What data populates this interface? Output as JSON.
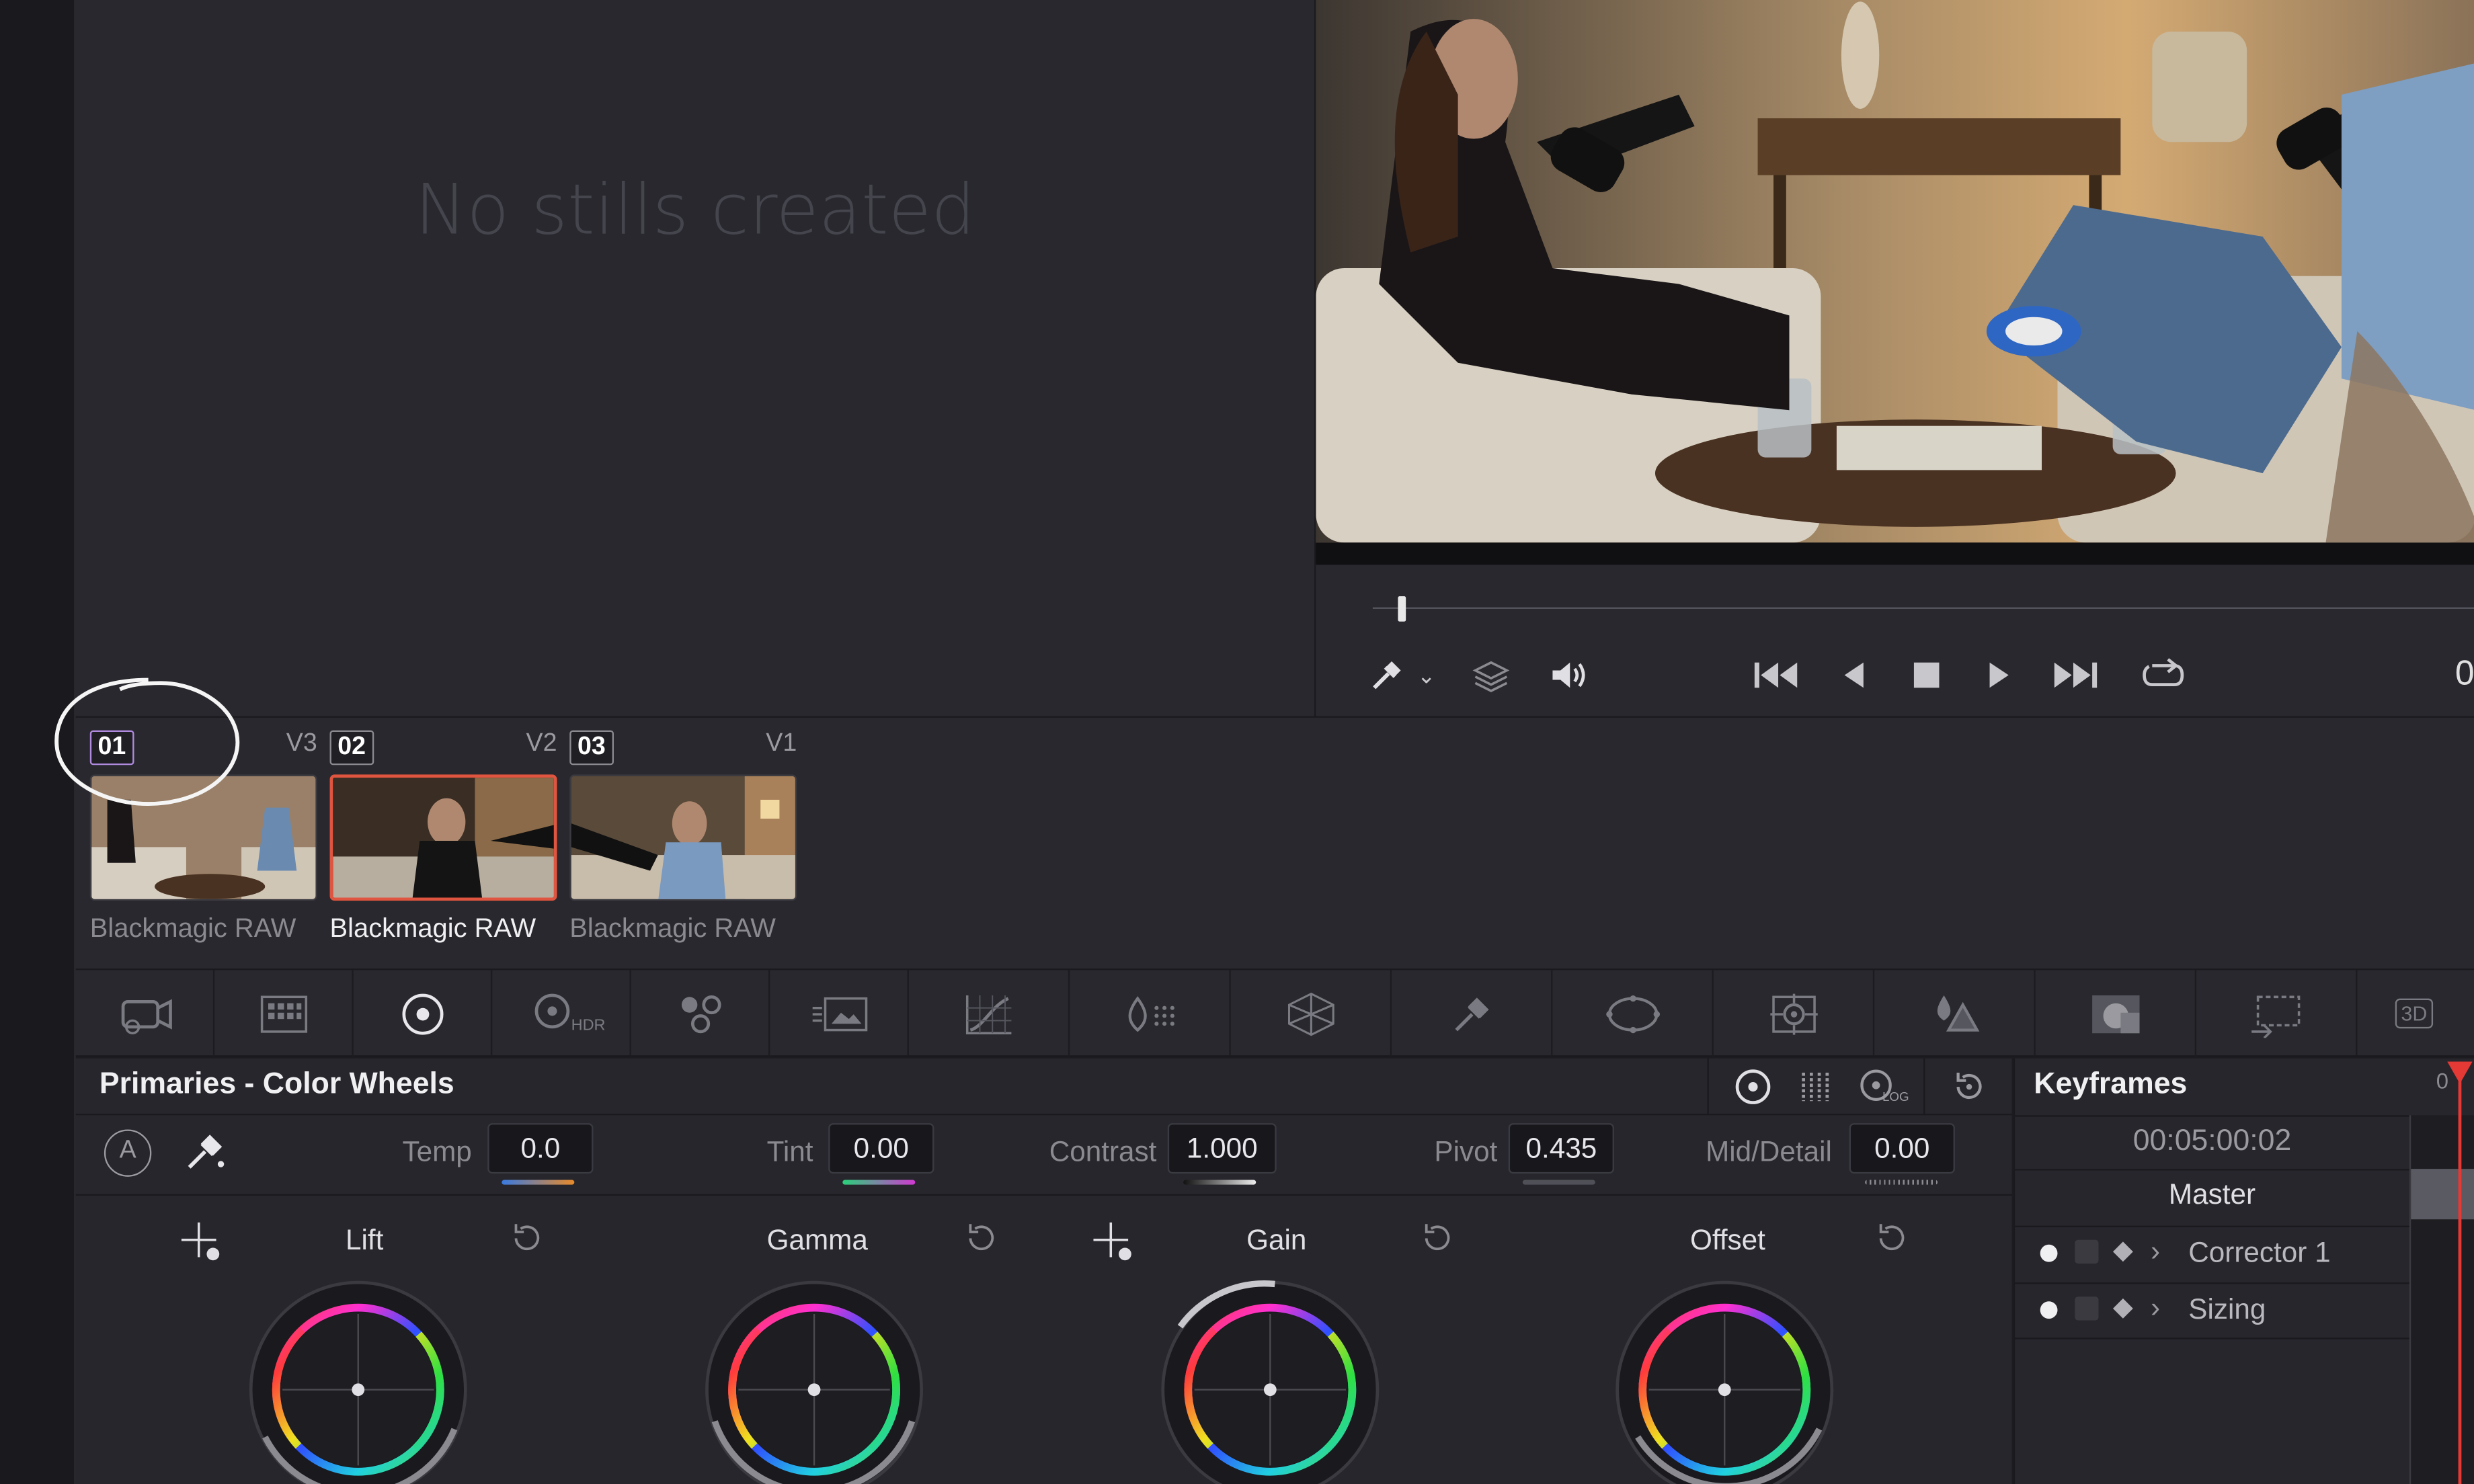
{
  "gallery": {
    "empty_message": "No stills created"
  },
  "viewer": {
    "timecode_partial": "0",
    "controls": [
      "picker-icon",
      "chevron-down-icon",
      "layers-icon",
      "volume-icon",
      "skip-start-icon",
      "prev-frame-icon",
      "stop-icon",
      "play-icon",
      "skip-end-icon",
      "loop-icon"
    ]
  },
  "clips": [
    {
      "number": "01",
      "track": "V3",
      "label": "Blackmagic RAW",
      "selected": false
    },
    {
      "number": "02",
      "track": "V2",
      "label": "Blackmagic RAW",
      "selected": true
    },
    {
      "number": "03",
      "track": "V1",
      "label": "Blackmagic RAW",
      "selected": false
    }
  ],
  "toolbar": {
    "tools": [
      "camera-raw-icon",
      "color-match-icon",
      "color-wheels-icon",
      "hdr-wheels-icon",
      "rgb-mixer-icon",
      "motion-effects-icon",
      "curves-icon",
      "color-warper-icon",
      "qualifier-icon",
      "window-icon",
      "tracker-icon",
      "magic-mask-icon",
      "blur-icon",
      "key-icon",
      "sizing-icon",
      "3d-icon"
    ],
    "hdr_label": "HDR",
    "three_d_label": "3D"
  },
  "primaries": {
    "title": "Primaries - Color Wheels",
    "log_label": "LOG",
    "auto_label": "A",
    "adjustments": {
      "temp_label": "Temp",
      "temp_value": "0.0",
      "tint_label": "Tint",
      "tint_value": "0.00",
      "contrast_label": "Contrast",
      "contrast_value": "1.000",
      "pivot_label": "Pivot",
      "pivot_value": "0.435",
      "mid_detail_label": "Mid/Detail",
      "mid_detail_value": "0.00"
    },
    "wheels": [
      "Lift",
      "Gamma",
      "Gain",
      "Offset"
    ]
  },
  "keyframes": {
    "title": "Keyframes",
    "timecode": "00:05:00:02",
    "track_timecode_partial": "0",
    "master_label": "Master",
    "rows": [
      "Corrector 1",
      "Sizing"
    ]
  },
  "colors": {
    "accent_red": "#e0553f",
    "panel": "#28282e",
    "playhead": "#e53935"
  }
}
